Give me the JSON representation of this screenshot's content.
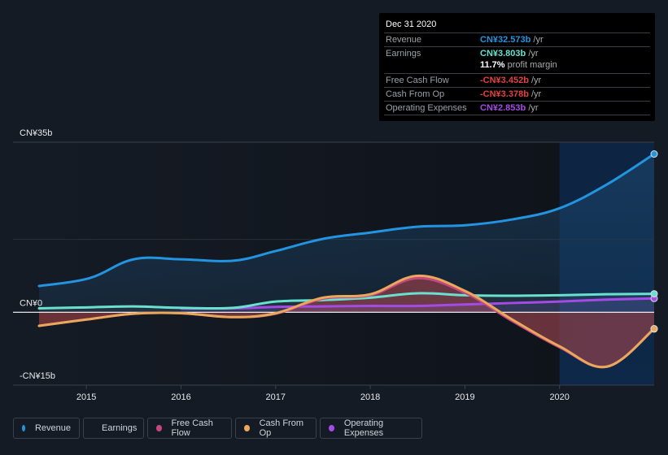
{
  "tooltip": {
    "date": "Dec 31 2020",
    "rows": [
      {
        "label": "Revenue",
        "value": "CN¥32.573b",
        "unit": " /yr",
        "color": "#2394df"
      },
      {
        "label": "Earnings",
        "value": "CN¥3.803b",
        "unit": " /yr",
        "color": "#6ae0cf"
      },
      {
        "label": "Free Cash Flow",
        "value": "-CN¥3.452b",
        "unit": " /yr",
        "color": "#e64141"
      },
      {
        "label": "Cash From Op",
        "value": "-CN¥3.378b",
        "unit": " /yr",
        "color": "#e64141"
      },
      {
        "label": "Operating Expenses",
        "value": "CN¥2.853b",
        "unit": " /yr",
        "color": "#a44be6"
      }
    ],
    "profit_margin": {
      "value": "11.7%",
      "label": " profit margin"
    }
  },
  "legend": [
    {
      "label": "Revenue",
      "color": "#2394df"
    },
    {
      "label": "Earnings",
      "color": "#6ae0cf"
    },
    {
      "label": "Free Cash Flow",
      "color": "#c4477f"
    },
    {
      "label": "Cash From Op",
      "color": "#e9a85a"
    },
    {
      "label": "Operating Expenses",
      "color": "#a44be6"
    }
  ],
  "chart_data": {
    "type": "area",
    "title": "",
    "xlabel": "",
    "ylabel": "",
    "ylim": [
      -15,
      35
    ],
    "xlim": [
      2014.5,
      2021.0
    ],
    "y_ticks": [
      {
        "value": 35,
        "label": "CN¥35b"
      },
      {
        "value": 0,
        "label": "CN¥0"
      },
      {
        "value": -15,
        "label": "-CN¥15b"
      }
    ],
    "x_ticks": [
      2015,
      2016,
      2017,
      2018,
      2019,
      2020
    ],
    "highlight_region_start": 2020.0,
    "grid": true,
    "legend_position": "bottom-left",
    "series": [
      {
        "name": "Revenue",
        "color": "#2394df",
        "x": [
          2014.5,
          2015.03,
          2015.5,
          2016.0,
          2016.55,
          2017.0,
          2017.5,
          2018.0,
          2018.5,
          2019.0,
          2019.5,
          2020.0,
          2020.5,
          2021.0
        ],
        "values": [
          5.4,
          7.0,
          10.9,
          10.9,
          10.6,
          12.6,
          15.1,
          16.4,
          17.6,
          17.9,
          19.1,
          21.4,
          26.3,
          32.57
        ]
      },
      {
        "name": "Earnings",
        "color": "#6ae0cf",
        "x": [
          2014.5,
          2015.0,
          2015.5,
          2016.0,
          2016.55,
          2017.0,
          2017.5,
          2018.0,
          2018.5,
          2019.0,
          2019.5,
          2020.0,
          2020.5,
          2021.0
        ],
        "values": [
          0.8,
          1.0,
          1.2,
          0.9,
          0.9,
          2.2,
          2.5,
          3.0,
          3.9,
          3.5,
          3.4,
          3.5,
          3.7,
          3.8
        ]
      },
      {
        "name": "Free Cash Flow",
        "color": "#c4477f",
        "x": [
          2014.5,
          2015.0,
          2015.5,
          2016.0,
          2016.55,
          2017.0,
          2017.5,
          2018.0,
          2018.5,
          2019.0,
          2019.5,
          2020.0,
          2020.5,
          2021.0
        ],
        "values": [
          -2.8,
          -1.5,
          -0.3,
          -0.2,
          -1.0,
          -0.3,
          2.8,
          3.5,
          7.0,
          4.0,
          -1.8,
          -7.2,
          -11.2,
          -3.45
        ]
      },
      {
        "name": "Cash From Op",
        "color": "#e9a85a",
        "x": [
          2014.5,
          2015.0,
          2015.5,
          2016.0,
          2016.55,
          2017.0,
          2017.5,
          2018.0,
          2018.5,
          2019.0,
          2019.5,
          2020.0,
          2020.5,
          2021.0
        ],
        "values": [
          -2.8,
          -1.5,
          -0.3,
          -0.2,
          -1.0,
          -0.2,
          3.0,
          3.7,
          7.5,
          4.4,
          -1.5,
          -7.0,
          -11.2,
          -3.38
        ]
      },
      {
        "name": "Operating Expenses",
        "color": "#a44be6",
        "x": [
          2016.0,
          2016.55,
          2017.0,
          2017.5,
          2018.0,
          2018.5,
          2019.0,
          2019.5,
          2020.0,
          2020.5,
          2021.0
        ],
        "values": [
          0.8,
          0.8,
          1.1,
          1.2,
          1.3,
          1.3,
          1.6,
          1.9,
          2.2,
          2.6,
          2.85
        ]
      }
    ]
  }
}
